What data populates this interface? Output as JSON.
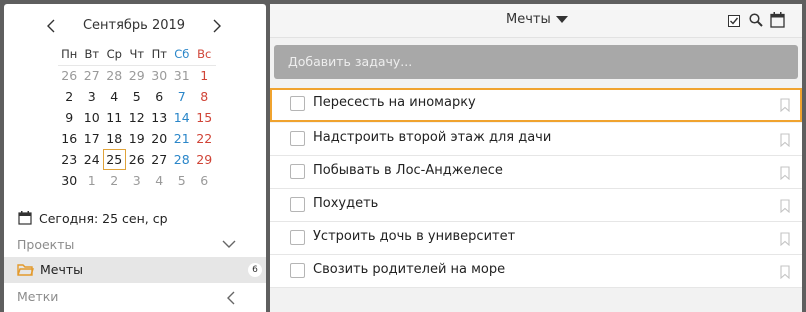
{
  "calendar": {
    "title": "Сентябрь 2019",
    "weekdays": [
      "Пн",
      "Вт",
      "Ср",
      "Чт",
      "Пт",
      "Сб",
      "Вс"
    ],
    "weeks": [
      [
        {
          "d": "26",
          "dim": true
        },
        {
          "d": "27",
          "dim": true
        },
        {
          "d": "28",
          "dim": true
        },
        {
          "d": "29",
          "dim": true
        },
        {
          "d": "30",
          "dim": true
        },
        {
          "d": "31",
          "dim": true
        },
        {
          "d": "1"
        }
      ],
      [
        {
          "d": "2"
        },
        {
          "d": "3"
        },
        {
          "d": "4"
        },
        {
          "d": "5"
        },
        {
          "d": "6"
        },
        {
          "d": "7"
        },
        {
          "d": "8"
        }
      ],
      [
        {
          "d": "9"
        },
        {
          "d": "10"
        },
        {
          "d": "11"
        },
        {
          "d": "12"
        },
        {
          "d": "13"
        },
        {
          "d": "14"
        },
        {
          "d": "15"
        }
      ],
      [
        {
          "d": "16"
        },
        {
          "d": "17"
        },
        {
          "d": "18"
        },
        {
          "d": "19"
        },
        {
          "d": "20"
        },
        {
          "d": "21"
        },
        {
          "d": "22"
        }
      ],
      [
        {
          "d": "23"
        },
        {
          "d": "24"
        },
        {
          "d": "25",
          "today": true
        },
        {
          "d": "26"
        },
        {
          "d": "27"
        },
        {
          "d": "28"
        },
        {
          "d": "29"
        }
      ],
      [
        {
          "d": "30"
        },
        {
          "d": "1",
          "dim": true
        },
        {
          "d": "2",
          "dim": true
        },
        {
          "d": "3",
          "dim": true
        },
        {
          "d": "4",
          "dim": true
        },
        {
          "d": "5",
          "dim": true
        },
        {
          "d": "6",
          "dim": true
        }
      ]
    ]
  },
  "sidebar": {
    "today_text": "Сегодня: 25 сен, ср",
    "projects_label": "Проекты",
    "dreams_label": "Мечты",
    "dreams_count": "6",
    "tags_label": "Метки"
  },
  "list": {
    "title": "Мечты",
    "add_placeholder": "Добавить задачу...",
    "tasks": [
      {
        "text": "Пересесть на иномарку",
        "selected": true
      },
      {
        "text": "Надстроить второй этаж для дачи"
      },
      {
        "text": "Побывать в Лос-Анджелесе"
      },
      {
        "text": "Похудеть"
      },
      {
        "text": "Устроить дочь в университет"
      },
      {
        "text": "Свозить родителей на море"
      }
    ]
  },
  "colors": {
    "saturday": "#2a86c9",
    "sunday": "#d04437",
    "today_border": "#e0a33a",
    "selected_border": "#f0a32f"
  }
}
